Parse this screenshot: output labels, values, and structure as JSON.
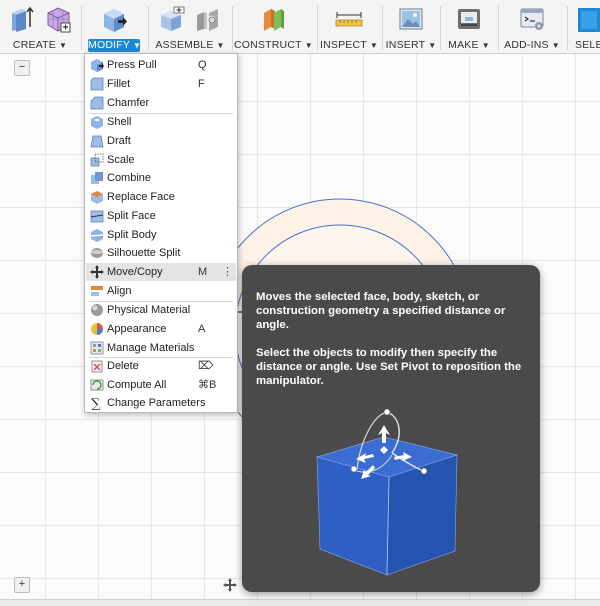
{
  "toolbar": {
    "groups": [
      {
        "label": "CREATE",
        "icons": [
          "create-extrude-icon",
          "create-box-icon"
        ]
      },
      {
        "label": "MODIFY",
        "icons": [
          "press-pull-icon"
        ],
        "active": true
      },
      {
        "label": "ASSEMBLE",
        "icons": [
          "new-component-icon",
          "joint-icon"
        ]
      },
      {
        "label": "CONSTRUCT",
        "icons": [
          "offset-plane-icon"
        ]
      },
      {
        "label": "INSPECT",
        "icons": [
          "measure-icon"
        ]
      },
      {
        "label": "INSERT",
        "icons": [
          "insert-image-icon"
        ]
      },
      {
        "label": "MAKE",
        "icons": [
          "3d-print-icon"
        ]
      },
      {
        "label": "ADD-INS",
        "icons": [
          "scripts-icon"
        ]
      },
      {
        "label": "SELEC",
        "icons": [
          "select-icon"
        ]
      }
    ],
    "active_color": "#1e88d6"
  },
  "modify_menu": {
    "items": [
      {
        "label": "Press Pull",
        "shortcut": "Q",
        "icon": "press-pull-icon"
      },
      {
        "label": "Fillet",
        "shortcut": "F",
        "icon": "fillet-icon"
      },
      {
        "label": "Chamfer",
        "shortcut": "",
        "icon": "chamfer-icon"
      },
      {
        "label": "Shell",
        "shortcut": "",
        "icon": "shell-icon"
      },
      {
        "label": "Draft",
        "shortcut": "",
        "icon": "draft-icon"
      },
      {
        "label": "Scale",
        "shortcut": "",
        "icon": "scale-icon"
      },
      {
        "label": "Combine",
        "shortcut": "",
        "icon": "combine-icon"
      },
      {
        "label": "Replace Face",
        "shortcut": "",
        "icon": "replace-face-icon"
      },
      {
        "label": "Split Face",
        "shortcut": "",
        "icon": "split-face-icon"
      },
      {
        "label": "Split Body",
        "shortcut": "",
        "icon": "split-body-icon"
      },
      {
        "label": "Silhouette Split",
        "shortcut": "",
        "icon": "silhouette-split-icon"
      },
      {
        "label": "Move/Copy",
        "shortcut": "M",
        "icon": "move-copy-icon",
        "highlighted": true
      },
      {
        "label": "Align",
        "shortcut": "",
        "icon": "align-icon"
      },
      {
        "label": "Physical Material",
        "shortcut": "",
        "icon": "physical-material-icon"
      },
      {
        "label": "Appearance",
        "shortcut": "A",
        "icon": "appearance-icon"
      },
      {
        "label": "Manage Materials",
        "shortcut": "",
        "icon": "manage-materials-icon"
      },
      {
        "label": "Delete",
        "shortcut": "⌦",
        "icon": "delete-icon"
      },
      {
        "label": "Compute All",
        "shortcut": "⌘B",
        "icon": "compute-all-icon"
      },
      {
        "label": "Change Parameters",
        "shortcut": "",
        "icon": "change-parameters-icon"
      }
    ],
    "more_glyph": "⋮"
  },
  "tooltip": {
    "paragraph_1": "Moves the selected face, body, sketch, or construction geometry a specified distance or angle.",
    "paragraph_2": "Select the objects to modify then specify the distance or angle. Use Set Pivot to reposition the manipulator.",
    "illustration": "move-manipulator-cube-icon",
    "cube_color": "#2f5fc4"
  },
  "canvas": {
    "panel_toggle_top": "−",
    "panel_toggle_bottom": "+",
    "sketch_color": "#4a6fd8",
    "fill_color": "#fdf2e6"
  }
}
